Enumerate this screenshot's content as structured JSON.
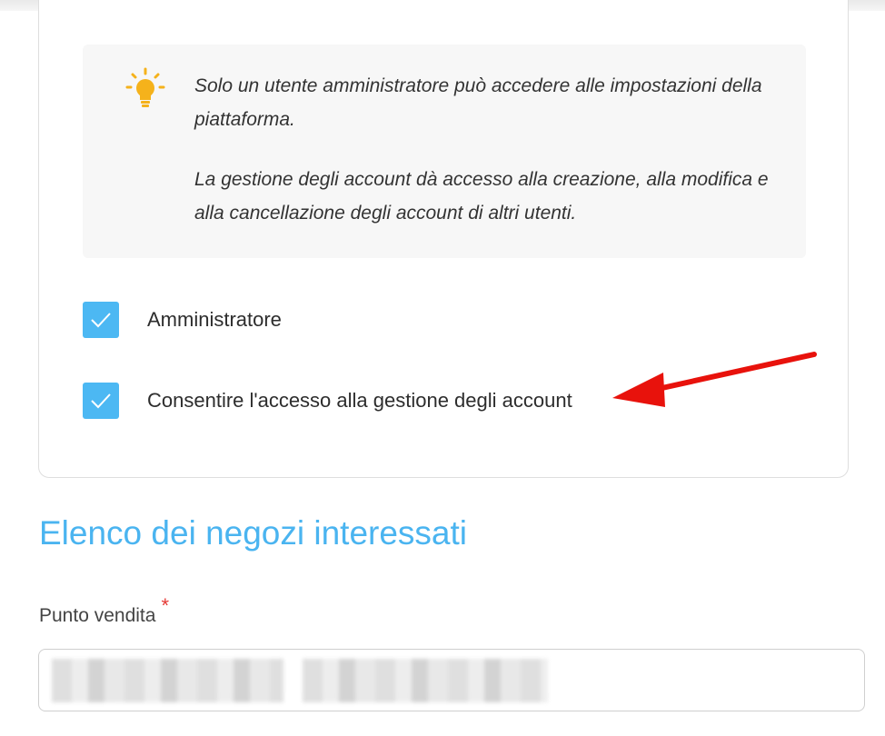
{
  "info_box": {
    "icon": "lightbulb-icon",
    "paragraph_1": "Solo un utente amministratore può accedere alle impostazioni della piattaforma.",
    "paragraph_2": "La gestione degli account dà accesso alla creazione, alla modifica e alla cancellazione degli account di altri utenti."
  },
  "checkboxes": [
    {
      "label": "Amministratore",
      "checked": true
    },
    {
      "label": "Consentire l'accesso alla gestione degli account",
      "checked": true
    }
  ],
  "stores_section": {
    "title": "Elenco dei negozi interessati",
    "field_label": "Punto vendita",
    "required_mark": "*",
    "field_value_blurred": true
  },
  "colors": {
    "accent": "#4cb8f3",
    "heading": "#4ab4f0",
    "bulb": "#f5b21b",
    "required": "#e53935",
    "annotation_arrow": "#e8120c"
  }
}
